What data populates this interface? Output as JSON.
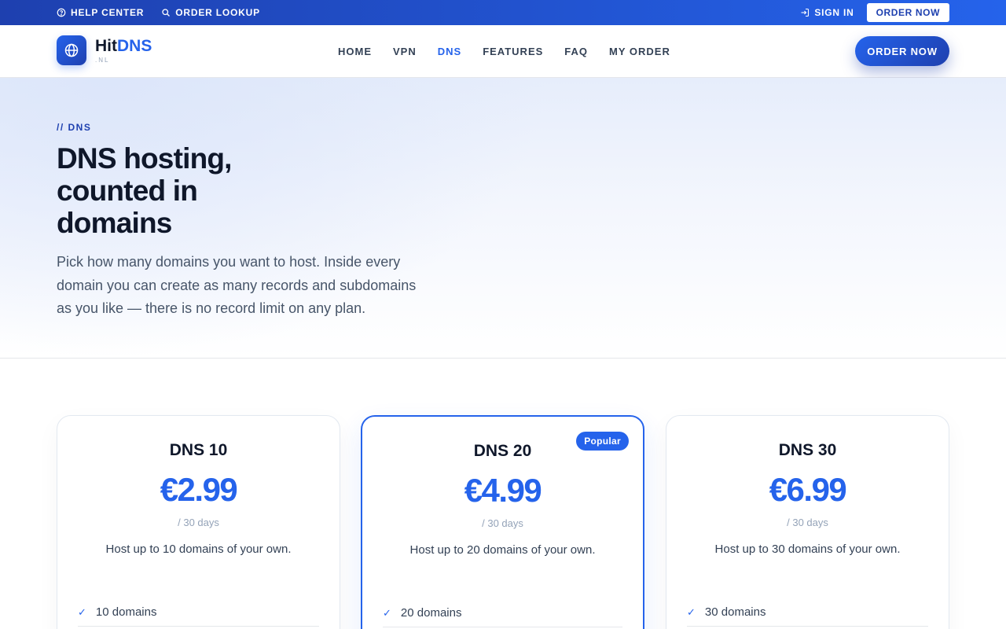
{
  "topbar": {
    "help_center": "HELP CENTER",
    "order_lookup": "ORDER LOOKUP",
    "sign_in": "SIGN IN",
    "order_now": "ORDER NOW"
  },
  "header": {
    "logo_name_a": "Hit",
    "logo_name_b": "DNS",
    "logo_sub": ".NL",
    "nav": [
      {
        "label": "HOME",
        "active": false
      },
      {
        "label": "VPN",
        "active": false
      },
      {
        "label": "DNS",
        "active": true
      },
      {
        "label": "FEATURES",
        "active": false
      },
      {
        "label": "FAQ",
        "active": false
      },
      {
        "label": "MY ORDER",
        "active": false
      }
    ],
    "order_now": "ORDER NOW"
  },
  "hero": {
    "eyebrow": "// DNS",
    "title": "DNS hosting, counted in domains",
    "description": "Pick how many domains you want to host. Inside every domain you can create as many records and subdomains as you like — there is no record limit on any plan."
  },
  "plans": [
    {
      "name": "DNS 10",
      "price": "€2.99",
      "period": "/ 30 days",
      "blurb": "Host up to 10 domains of your own.",
      "features": [
        "10 domains"
      ],
      "badge": ""
    },
    {
      "name": "DNS 20",
      "price": "€4.99",
      "period": "/ 30 days",
      "blurb": "Host up to 20 domains of your own.",
      "features": [
        "20 domains"
      ],
      "badge": "Popular"
    },
    {
      "name": "DNS 30",
      "price": "€6.99",
      "period": "/ 30 days",
      "blurb": "Host up to 30 domains of your own.",
      "features": [
        "30 domains"
      ],
      "badge": ""
    }
  ],
  "colors": {
    "brand": "#2563eb",
    "brand_dark": "#1e40af",
    "text": "#0f172a",
    "muted": "#94a3b8"
  },
  "icons": {
    "help": "help-circle-icon",
    "lookup": "search-icon",
    "sign_in": "sign-in-icon",
    "logo": "globe-icon",
    "check": "check-icon"
  }
}
